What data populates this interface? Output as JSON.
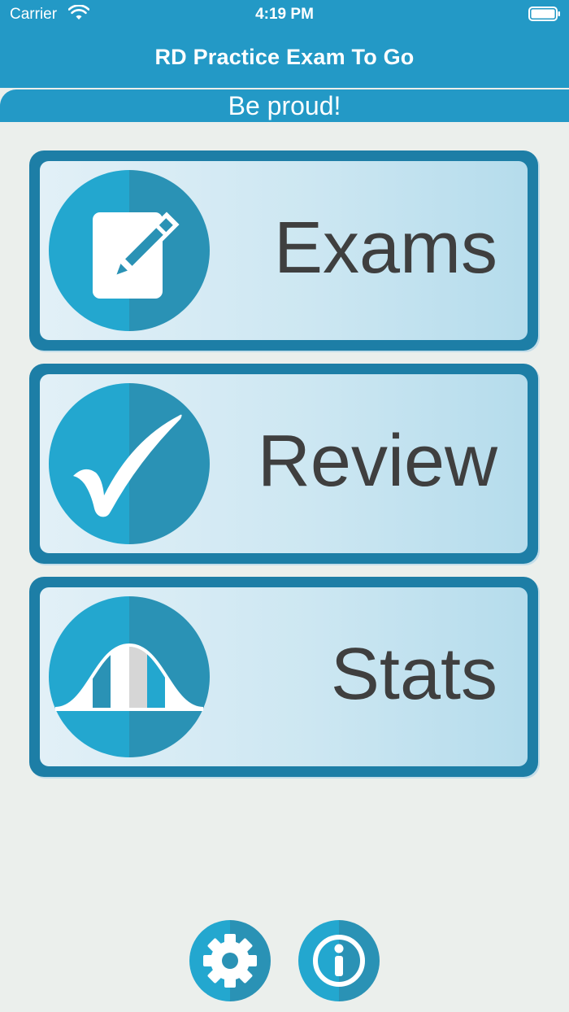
{
  "status_bar": {
    "carrier": "Carrier",
    "time": "4:19 PM"
  },
  "header": {
    "title": "RD Practice Exam To Go"
  },
  "banner": {
    "text": "Be proud!"
  },
  "menu": {
    "exams_label": "Exams",
    "review_label": "Review",
    "stats_label": "Stats"
  },
  "icons": {
    "exams": "notepad-pencil-icon",
    "review": "checkmark-icon",
    "stats": "bell-curve-icon",
    "settings": "gear-icon",
    "info": "info-icon"
  },
  "colors": {
    "primary": "#2399c6",
    "primary_dark": "#1d7ea6",
    "card_gradient_start": "#e2f0f7",
    "card_gradient_end": "#b5dcec",
    "label_text": "#3f3f3f",
    "background": "#ebefec"
  }
}
